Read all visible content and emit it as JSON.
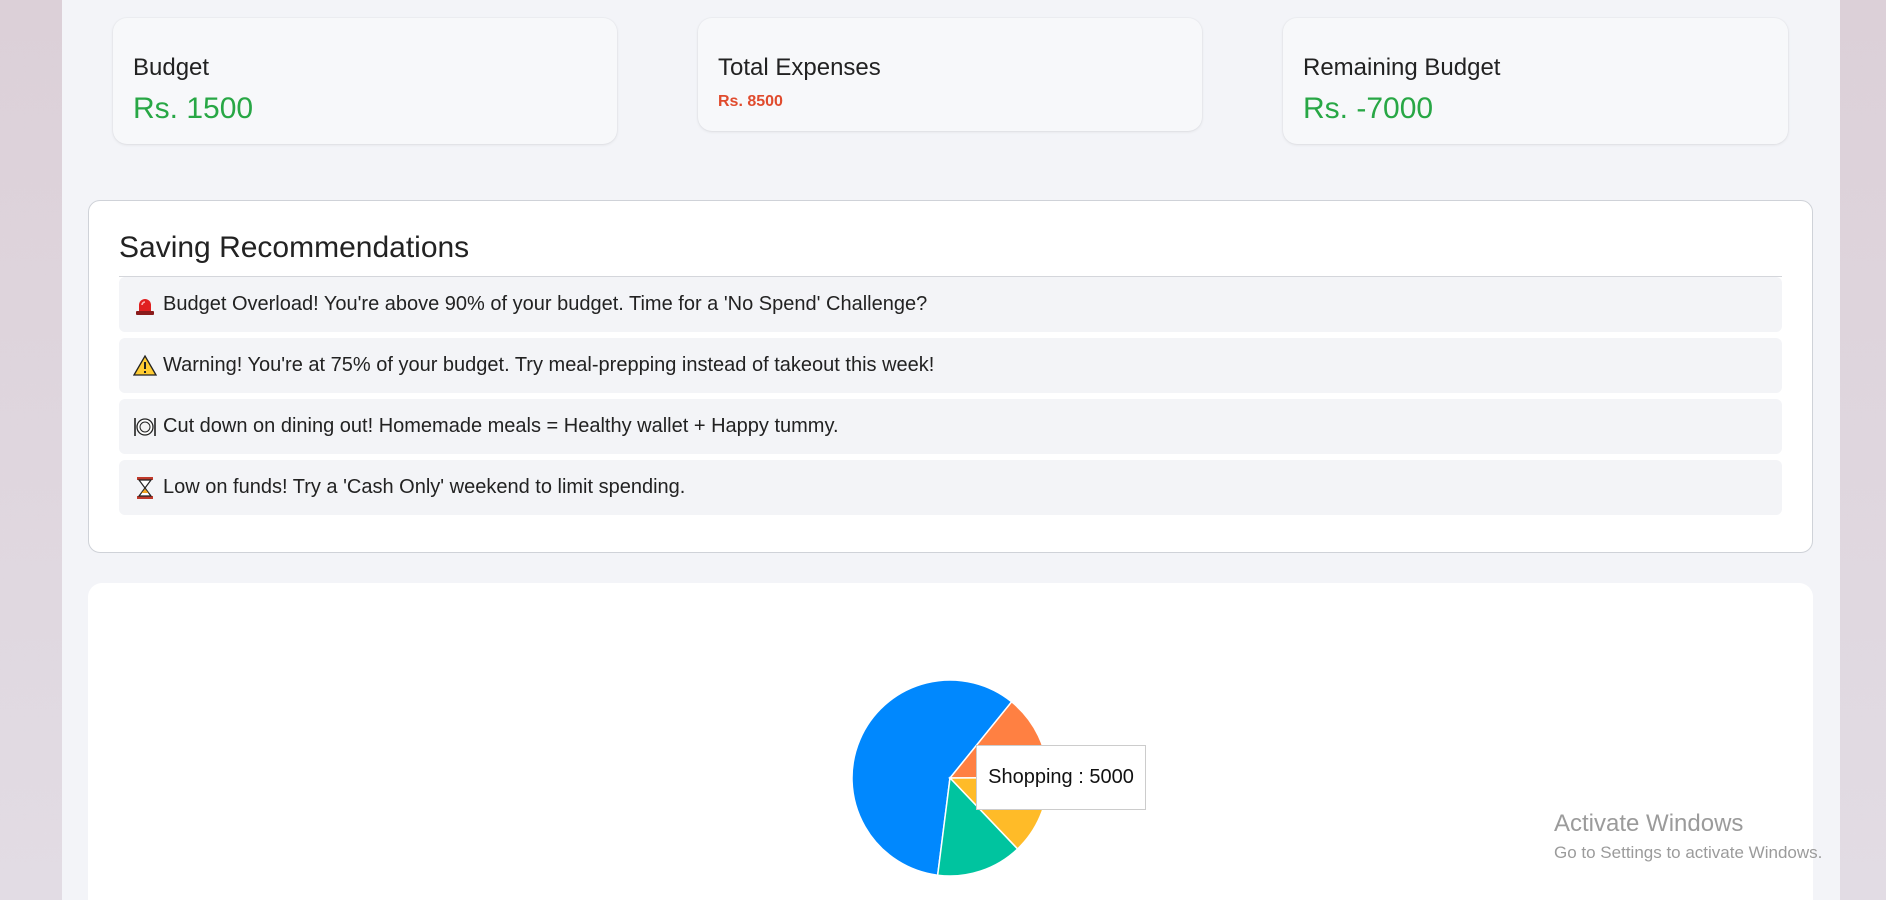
{
  "stats": {
    "budget": {
      "label": "Budget",
      "value": "Rs. 1500"
    },
    "expenses": {
      "label": "Total Expenses",
      "value": "Rs. 8500"
    },
    "remaining": {
      "label": "Remaining Budget",
      "value": "Rs. -7000"
    }
  },
  "recommendations": {
    "title": "Saving Recommendations",
    "items": [
      {
        "icon": "siren-icon",
        "text": "Budget Overload! You're above 90% of your budget. Time for a 'No Spend' Challenge?"
      },
      {
        "icon": "warning-icon",
        "text": "Warning! You're at 75% of your budget. Try meal-prepping instead of takeout this week!"
      },
      {
        "icon": "plate-icon",
        "text": "Cut down on dining out! Homemade meals = Healthy wallet + Happy tummy."
      },
      {
        "icon": "hourglass-icon",
        "text": "Low on funds! Try a 'Cash Only' weekend to limit spending."
      }
    ]
  },
  "chart_data": {
    "type": "pie",
    "slices": [
      {
        "name": "Shopping",
        "value": 5000,
        "color": "#0088fe"
      },
      {
        "category": "unlabeled",
        "value": 1200,
        "color": "#ff8042"
      },
      {
        "category": "unlabeled",
        "value": 1100,
        "color": "#ffbb28"
      },
      {
        "category": "unlabeled",
        "value": 1200,
        "color": "#00c49f"
      }
    ],
    "tooltip": "Shopping : 5000"
  },
  "colors": {
    "positive": "#28a745",
    "negative": "#e04b2d"
  },
  "watermark": {
    "title": "Activate Windows",
    "subtitle": "Go to Settings to activate Windows."
  }
}
